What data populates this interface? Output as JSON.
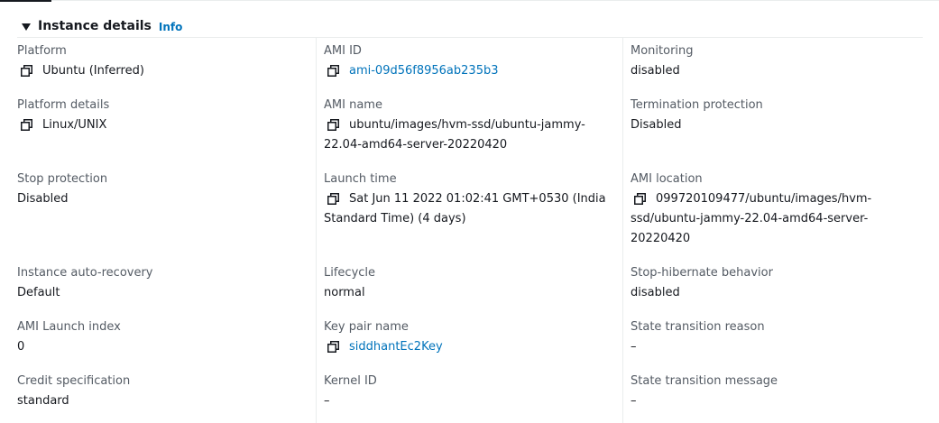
{
  "section": {
    "title": "Instance details",
    "info_label": "Info"
  },
  "fields": {
    "platform": {
      "label": "Platform",
      "value": "Ubuntu (Inferred)"
    },
    "platform_details": {
      "label": "Platform details",
      "value": "Linux/UNIX"
    },
    "stop_protection": {
      "label": "Stop protection",
      "value": "Disabled"
    },
    "auto_recovery": {
      "label": "Instance auto-recovery",
      "value": "Default"
    },
    "ami_launch_index": {
      "label": "AMI Launch index",
      "value": "0"
    },
    "credit_specification": {
      "label": "Credit specification",
      "value": "standard"
    },
    "ami_id": {
      "label": "AMI ID",
      "value": "ami-09d56f8956ab235b3"
    },
    "ami_name": {
      "label": "AMI name",
      "value_line1": "ubuntu/images/hvm-ssd/ubuntu-jammy-",
      "value_line2": "22.04-amd64-server-20220420"
    },
    "launch_time": {
      "label": "Launch time",
      "value_line1": "Sat Jun 11 2022 01:02:41 GMT+0530 (India",
      "value_line2": "Standard Time) (4 days)"
    },
    "lifecycle": {
      "label": "Lifecycle",
      "value": "normal"
    },
    "key_pair_name": {
      "label": "Key pair name",
      "value": "siddhantEc2Key"
    },
    "kernel_id": {
      "label": "Kernel ID",
      "value": "–"
    },
    "monitoring": {
      "label": "Monitoring",
      "value": "disabled"
    },
    "termination_protection": {
      "label": "Termination protection",
      "value": "Disabled"
    },
    "ami_location": {
      "label": "AMI location",
      "value_line1": "099720109477/ubuntu/images/hvm-",
      "value_line2": "ssd/ubuntu-jammy-22.04-amd64-server-",
      "value_line3": "20220420"
    },
    "stop_hibernate": {
      "label": "Stop-hibernate behavior",
      "value": "disabled"
    },
    "state_transition_reason": {
      "label": "State transition reason",
      "value": "–"
    },
    "state_transition_message": {
      "label": "State transition message",
      "value": "–"
    }
  },
  "icons": {
    "copy": "copy-icon",
    "expand": "caret-down-icon"
  },
  "colors": {
    "link": "#0073bb",
    "label": "#545b64",
    "text": "#16191f",
    "divider": "#eaeded"
  }
}
